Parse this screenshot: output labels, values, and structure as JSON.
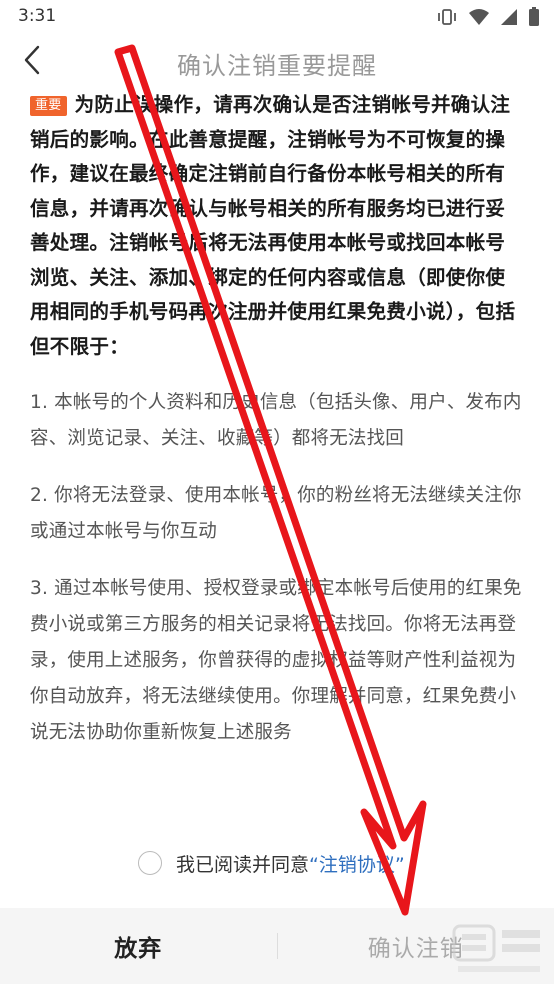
{
  "status_bar": {
    "time": "3:31",
    "icons": [
      "vibrate-icon",
      "wifi-icon",
      "signal-icon",
      "battery-icon"
    ]
  },
  "nav": {
    "title": "确认注销重要提醒",
    "back_icon": "chevron-left-icon"
  },
  "notice": {
    "badge": "重要",
    "text": "为防止误操作，请再次确认是否注销帐号并确认注销后的影响。在此善意提醒，注销帐号为不可恢复的操作，建议在最终确定注销前自行备份本帐号相关的所有信息，并请再次确认与帐号相关的所有服务均已进行妥善处理。注销帐号后将无法再使用本帐号或找回本帐号浏览、关注、添加、绑定的任何内容或信息（即使你使用相同的手机号码再次注册并使用红果免费小说），包括但不限于："
  },
  "clauses": [
    "1. 本帐号的个人资料和历史信息（包括头像、用户、发布内容、浏览记录、关注、收藏等）都将无法找回",
    "2. 你将无法登录、使用本帐号，你的粉丝将无法继续关注你或通过本帐号与你互动",
    "3. 通过本帐号使用、授权登录或绑定本帐号后使用的红果免费小说或第三方服务的相关记录将无法找回。你将无法再登录，使用上述服务，你曾获得的虚拟权益等财产性利益视为你自动放弃，将无法继续使用。你理解并同意，红果免费小说无法协助你重新恢复上述服务"
  ],
  "agreement": {
    "text": "我已阅读并同意",
    "link": "“注销协议”",
    "checked": false
  },
  "buttons": {
    "cancel": "放弃",
    "confirm": "确认注销"
  },
  "colors": {
    "badge": "#f0642c",
    "link": "#2f6fbf",
    "annotation_arrow": "#e8161b"
  }
}
